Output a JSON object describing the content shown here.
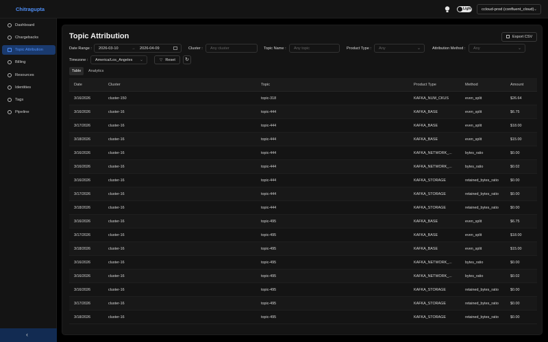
{
  "app": {
    "title": "Chitragupta"
  },
  "header": {
    "theme_toggle_label": "Light",
    "environment": "ccloud-prod (confluent_cloud)"
  },
  "sidebar": {
    "items": [
      {
        "label": "Dashboard",
        "icon": "dashboard-icon"
      },
      {
        "label": "Chargebacks",
        "icon": "chargebacks-icon"
      },
      {
        "label": "Topic Attribution",
        "icon": "chart-icon",
        "active": true
      },
      {
        "label": "Billing",
        "icon": "billing-icon"
      },
      {
        "label": "Resources",
        "icon": "resources-icon"
      },
      {
        "label": "Identities",
        "icon": "identities-icon"
      },
      {
        "label": "Tags",
        "icon": "tag-icon"
      },
      {
        "label": "Pipeline",
        "icon": "pipeline-icon"
      }
    ],
    "collapse_glyph": "‹"
  },
  "page": {
    "title": "Topic Attribution",
    "export_label": "Export CSV"
  },
  "filters": {
    "date_range_label": "Date Range :",
    "date_start": "2026-03-10",
    "date_separator": "→",
    "date_end": "2026-04-09",
    "cluster_label": "Cluster :",
    "cluster_placeholder": "Any cluster",
    "topic_label": "Topic Name :",
    "topic_placeholder": "Any topic",
    "product_label": "Product Type :",
    "product_placeholder": "Any",
    "method_label": "Attribution Method :",
    "method_placeholder": "Any",
    "timezone_label": "Timezone :",
    "timezone_value": "America/Los_Angeles",
    "reset_label": "Reset",
    "refresh_glyph": "↻"
  },
  "tabs": [
    {
      "label": "Table",
      "active": true
    },
    {
      "label": "Analytics",
      "active": false
    }
  ],
  "table": {
    "columns": [
      "Date",
      "Cluster",
      "Topic",
      "Product Type",
      "Method",
      "Amount"
    ],
    "rows": [
      [
        "3/16/2026",
        "cluster-150",
        "topic-318",
        "KAFKA_NUM_CKUS",
        "even_split",
        "$26.64"
      ],
      [
        "3/16/2026",
        "cluster-16",
        "topic-444",
        "KAFKA_BASE",
        "even_split",
        "$6.75"
      ],
      [
        "3/17/2026",
        "cluster-16",
        "topic-444",
        "KAFKA_BASE",
        "even_split",
        "$18.00"
      ],
      [
        "3/18/2026",
        "cluster-16",
        "topic-444",
        "KAFKA_BASE",
        "even_split",
        "$15.00"
      ],
      [
        "3/16/2026",
        "cluster-16",
        "topic-444",
        "KAFKA_NETWORK_...",
        "bytes_ratio",
        "$0.00"
      ],
      [
        "3/16/2026",
        "cluster-16",
        "topic-444",
        "KAFKA_NETWORK_...",
        "bytes_ratio",
        "$0.02"
      ],
      [
        "3/16/2026",
        "cluster-16",
        "topic-444",
        "KAFKA_STORAGE",
        "retained_bytes_ratio",
        "$0.00"
      ],
      [
        "3/17/2026",
        "cluster-16",
        "topic-444",
        "KAFKA_STORAGE",
        "retained_bytes_ratio",
        "$0.00"
      ],
      [
        "3/18/2026",
        "cluster-16",
        "topic-444",
        "KAFKA_STORAGE",
        "retained_bytes_ratio",
        "$0.00"
      ],
      [
        "3/16/2026",
        "cluster-16",
        "topic-495",
        "KAFKA_BASE",
        "even_split",
        "$6.75"
      ],
      [
        "3/17/2026",
        "cluster-16",
        "topic-495",
        "KAFKA_BASE",
        "even_split",
        "$18.00"
      ],
      [
        "3/18/2026",
        "cluster-16",
        "topic-495",
        "KAFKA_BASE",
        "even_split",
        "$15.00"
      ],
      [
        "3/16/2026",
        "cluster-16",
        "topic-495",
        "KAFKA_NETWORK_...",
        "bytes_ratio",
        "$0.00"
      ],
      [
        "3/16/2026",
        "cluster-16",
        "topic-495",
        "KAFKA_NETWORK_...",
        "bytes_ratio",
        "$0.02"
      ],
      [
        "3/16/2026",
        "cluster-16",
        "topic-495",
        "KAFKA_STORAGE",
        "retained_bytes_ratio",
        "$0.00"
      ],
      [
        "3/17/2026",
        "cluster-16",
        "topic-495",
        "KAFKA_STORAGE",
        "retained_bytes_ratio",
        "$0.00"
      ],
      [
        "3/18/2026",
        "cluster-16",
        "topic-495",
        "KAFKA_STORAGE",
        "retained_bytes_ratio",
        "$0.00"
      ]
    ]
  },
  "colors": {
    "accent": "#4f8ff7",
    "active_nav_bg": "#1a3a6e",
    "background": "#000000",
    "panel": "#141414"
  }
}
